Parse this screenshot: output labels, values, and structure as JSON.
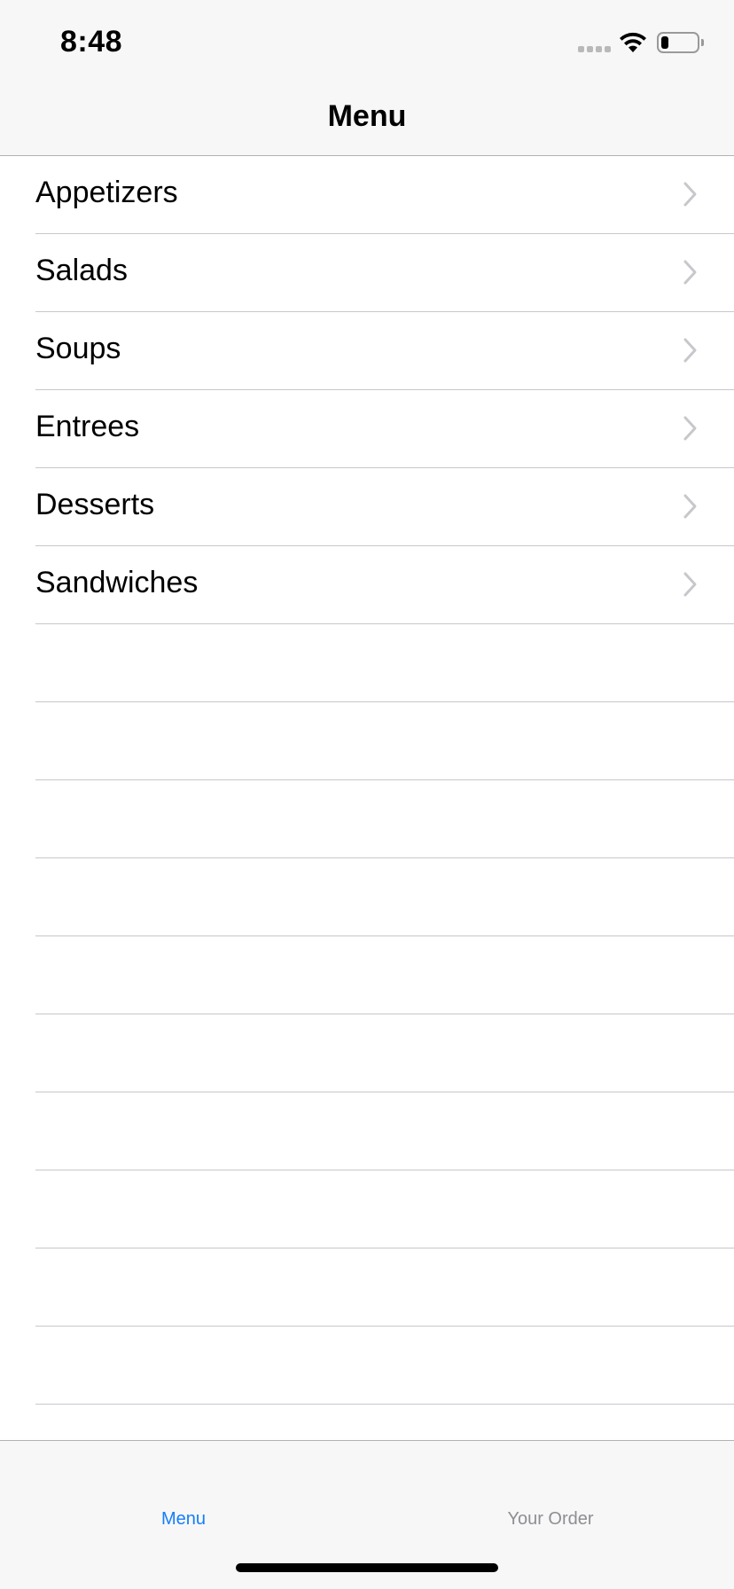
{
  "status_bar": {
    "time": "8:48",
    "battery_level": 0.22
  },
  "nav": {
    "title": "Menu"
  },
  "menu_categories": [
    {
      "label": "Appetizers"
    },
    {
      "label": "Salads"
    },
    {
      "label": "Soups"
    },
    {
      "label": "Entrees"
    },
    {
      "label": "Desserts"
    },
    {
      "label": "Sandwiches"
    }
  ],
  "tab_bar": {
    "tabs": [
      {
        "label": "Menu",
        "selected": true
      },
      {
        "label": "Your Order",
        "selected": false
      }
    ]
  },
  "colors": {
    "accent": "#147efb",
    "inactive_tab": "#8e8e93",
    "chevron": "#c7c7cc",
    "separator": "#c8c7cc",
    "bar_background": "#f7f7f7"
  },
  "icons": {
    "wifi": "wifi-icon",
    "battery": "battery-icon",
    "signal": "cellular-signal-icon",
    "chevron": "chevron-right-icon"
  }
}
